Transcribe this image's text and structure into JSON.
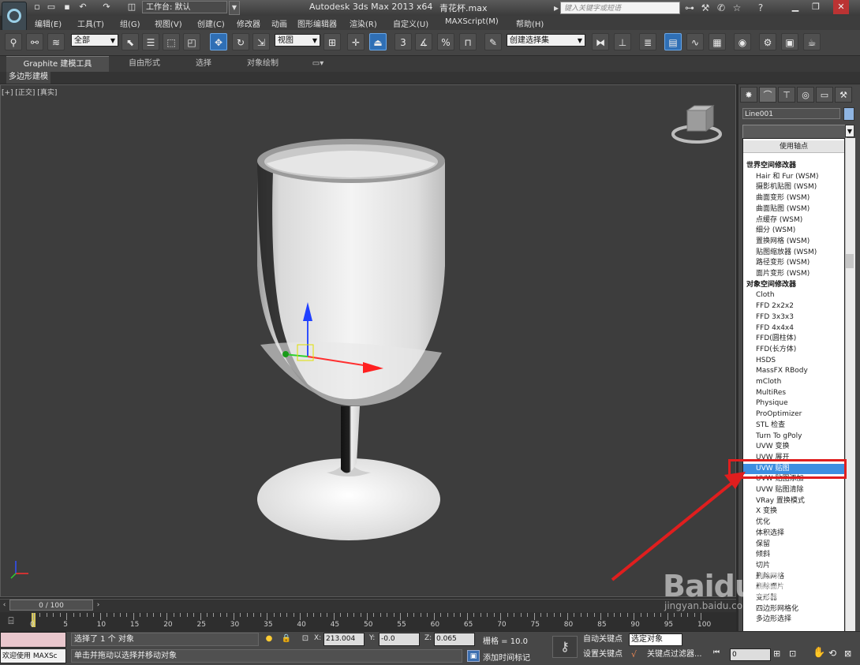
{
  "titlebar": {
    "workspace": "工作台: 默认",
    "app_title": "Autodesk 3ds Max  2013 x64",
    "file_name": "青花杯.max",
    "search_placeholder": "键入关键字或短语"
  },
  "menu": [
    "编辑(E)",
    "工具(T)",
    "组(G)",
    "视图(V)",
    "创建(C)",
    "修改器",
    "动画",
    "图形编辑器",
    "渲染(R)",
    "自定义(U)",
    "MAXScript(M)",
    "帮助(H)"
  ],
  "toolbar": {
    "selection_filter": "全部",
    "ref_coord": "视图",
    "named_selection": "创建选择集",
    "snap_labels": [
      "3",
      "%"
    ]
  },
  "ribbon": {
    "tabs": [
      "Graphite 建模工具",
      "自由形式",
      "选择",
      "对象绘制"
    ],
    "subtab": "多边形建模"
  },
  "viewport": {
    "label": "[+] [正交] [真实]"
  },
  "command_panel": {
    "object_name": "Line001",
    "modifier_list": [
      {
        "text": "使用轴点",
        "kind": "top"
      },
      {
        "text": "世界空间修改器",
        "kind": "hdr"
      },
      {
        "text": "Hair 和 Fur (WSM)",
        "kind": "item"
      },
      {
        "text": "摄影机贴图 (WSM)",
        "kind": "item"
      },
      {
        "text": "曲面变形 (WSM)",
        "kind": "item"
      },
      {
        "text": "曲面贴图 (WSM)",
        "kind": "item"
      },
      {
        "text": "点缓存 (WSM)",
        "kind": "item"
      },
      {
        "text": "细分 (WSM)",
        "kind": "item"
      },
      {
        "text": "置换网格 (WSM)",
        "kind": "item"
      },
      {
        "text": "贴图缩放器 (WSM)",
        "kind": "item"
      },
      {
        "text": "路径变形 (WSM)",
        "kind": "item"
      },
      {
        "text": "面片变形 (WSM)",
        "kind": "item"
      },
      {
        "text": "对象空间修改器",
        "kind": "hdr"
      },
      {
        "text": "Cloth",
        "kind": "item"
      },
      {
        "text": "FFD 2x2x2",
        "kind": "item"
      },
      {
        "text": "FFD 3x3x3",
        "kind": "item"
      },
      {
        "text": "FFD 4x4x4",
        "kind": "item"
      },
      {
        "text": "FFD(圆柱体)",
        "kind": "item"
      },
      {
        "text": "FFD(长方体)",
        "kind": "item"
      },
      {
        "text": "HSDS",
        "kind": "item"
      },
      {
        "text": "MassFX RBody",
        "kind": "item"
      },
      {
        "text": "mCloth",
        "kind": "item"
      },
      {
        "text": "MultiRes",
        "kind": "item"
      },
      {
        "text": "Physique",
        "kind": "item"
      },
      {
        "text": "ProOptimizer",
        "kind": "item"
      },
      {
        "text": "STL 检查",
        "kind": "item"
      },
      {
        "text": "Turn To gPoly",
        "kind": "item"
      },
      {
        "text": "UVW 变换",
        "kind": "item"
      },
      {
        "text": "UVW 展开",
        "kind": "item"
      },
      {
        "text": "UVW 贴图",
        "kind": "sel"
      },
      {
        "text": "UVW 贴图添加",
        "kind": "item"
      },
      {
        "text": "UVW 贴图清除",
        "kind": "item"
      },
      {
        "text": "VRay 置换模式",
        "kind": "item"
      },
      {
        "text": "X 变换",
        "kind": "item"
      },
      {
        "text": "优化",
        "kind": "item"
      },
      {
        "text": "体积选择",
        "kind": "item"
      },
      {
        "text": "保留",
        "kind": "item"
      },
      {
        "text": "倾斜",
        "kind": "item"
      },
      {
        "text": "切片",
        "kind": "item"
      },
      {
        "text": "删除网格",
        "kind": "item"
      },
      {
        "text": "删除面片",
        "kind": "item"
      },
      {
        "text": "变形器",
        "kind": "item"
      },
      {
        "text": "四边形网格化",
        "kind": "item"
      },
      {
        "text": "多边形选择",
        "kind": "item"
      }
    ]
  },
  "timeline": {
    "slider": "0 / 100",
    "ticks": [
      0,
      5,
      10,
      15,
      20,
      25,
      30,
      35,
      40,
      45,
      50,
      55,
      60,
      65,
      70,
      75,
      80,
      85,
      90,
      95,
      100
    ]
  },
  "status": {
    "welcome": "欢迎使用 MAXSc",
    "selected": "选择了 1 个 对象",
    "prompt": "单击并拖动以选择并移动对象",
    "x_label": "X:",
    "x_value": "213.004",
    "y_label": "Y:",
    "y_value": "-0.0",
    "z_label": "Z:",
    "z_value": "0.065",
    "grid": "栅格 = 10.0",
    "add_time_tag": "添加时间标记",
    "auto_key": "自动关键点",
    "set_key": "设置关键点",
    "selected_object": "选定对象",
    "key_filters": "关键点过滤器...",
    "frame": "0"
  },
  "watermark": {
    "brand": "Baidu经验",
    "url": "jingyan.baidu.com"
  },
  "colors": {
    "highlight": "#3d8ee0",
    "annotation": "#e01e1e"
  }
}
